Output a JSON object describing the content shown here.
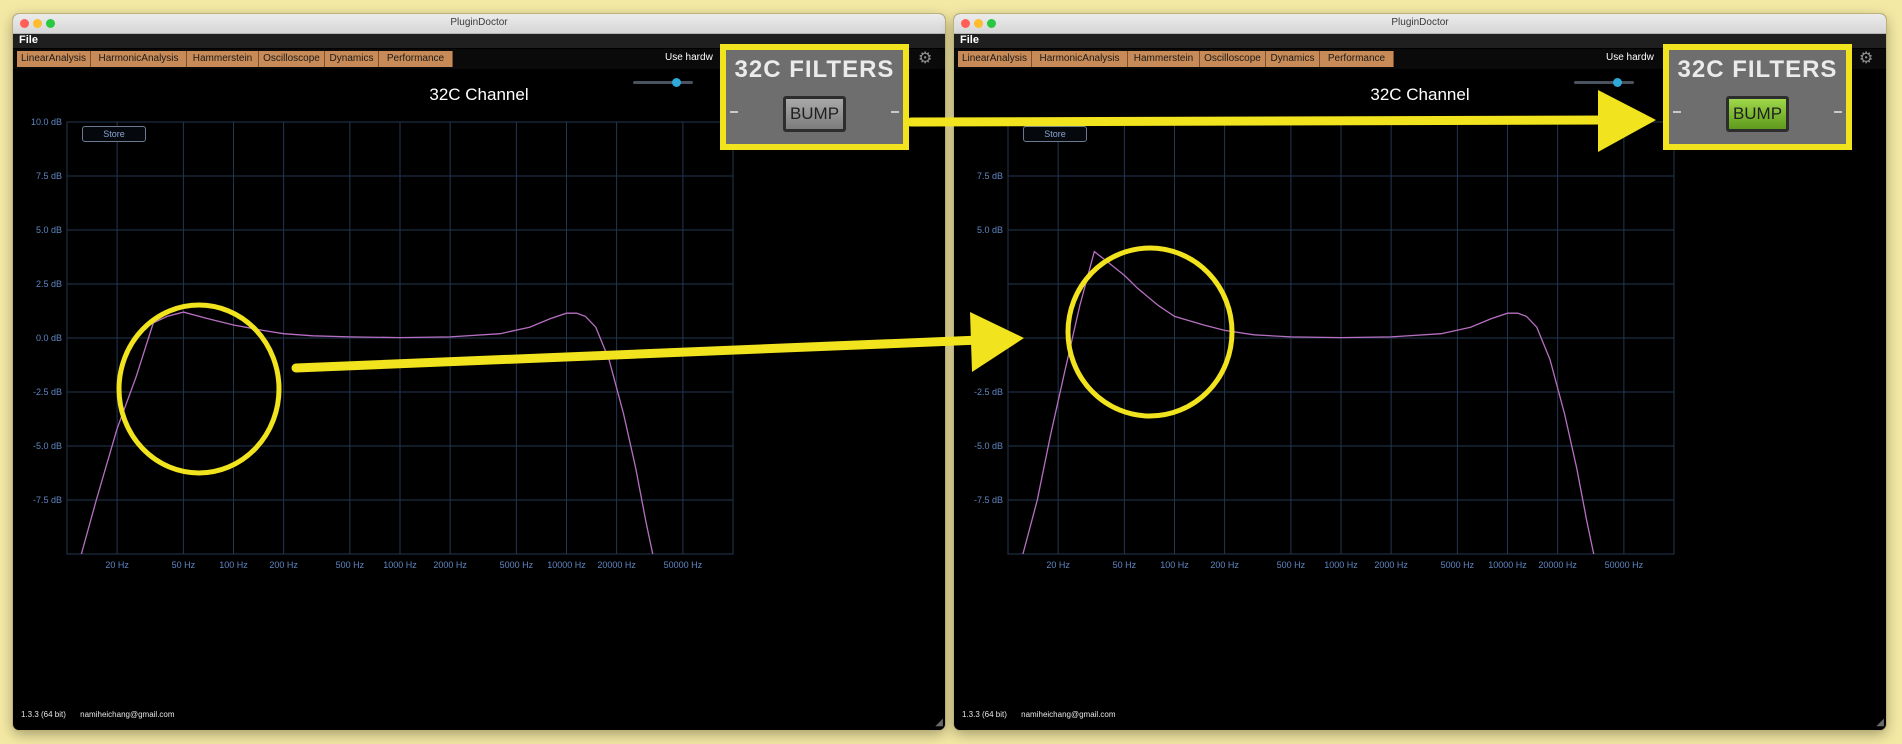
{
  "colors": {
    "highlight": "#f1e31d",
    "curve": "#b66fc1",
    "grid": "#233651",
    "tab": "#c88b57",
    "bump_on": "#7cc33a"
  },
  "window_title": "PluginDoctor",
  "menu": {
    "file": "File"
  },
  "tabs": [
    "LinearAnalysis",
    "HarmonicAnalysis",
    "Hammerstein",
    "Oscilloscope",
    "Dynamics",
    "Performance"
  ],
  "use_hardware_label": "Use hardw",
  "gear_icon": "gear-icon",
  "store_button": "Store",
  "footer": {
    "version": "1.3.3 (64 bit)",
    "email": "namiheichang@gmail.com"
  },
  "filters_panel": {
    "title": "32C FILTERS",
    "button": "BUMP"
  },
  "left": {
    "bump_state": "off",
    "slider_level": 0.72
  },
  "right": {
    "bump_state": "on",
    "slider_level": 0.72
  },
  "chart_data": [
    {
      "type": "line",
      "title": "32C Channel",
      "x_scale": "log",
      "xlim": [
        10,
        100000
      ],
      "ylim": [
        -10,
        10
      ],
      "grid": true,
      "y_ticks": [
        10,
        7.5,
        5,
        2.5,
        0,
        -2.5,
        -5,
        -7.5
      ],
      "y_tick_labels": [
        "10.0 dB",
        "7.5 dB",
        "5.0 dB",
        "2.5 dB",
        "0.0 dB",
        "-2.5 dB",
        "-5.0 dB",
        "-7.5 dB"
      ],
      "x_ticks": [
        20,
        50,
        100,
        200,
        500,
        1000,
        2000,
        5000,
        10000,
        20000,
        50000
      ],
      "x_tick_labels": [
        "20 Hz",
        "50 Hz",
        "100 Hz",
        "200 Hz",
        "500 Hz",
        "1000 Hz",
        "2000 Hz",
        "5000 Hz",
        "10000 Hz",
        "20000 Hz",
        "50000 Hz"
      ],
      "series": [
        {
          "x": [
            12,
            15,
            20,
            26,
            33,
            40,
            50,
            70,
            100,
            150,
            200,
            300,
            500,
            1000,
            2000,
            4000,
            6000,
            8000,
            10000,
            11500,
            13000,
            15000,
            18000,
            22000,
            26000,
            30000,
            34000
          ],
          "y": [
            -10.2,
            -7.5,
            -4.2,
            -1.8,
            0.7,
            1.0,
            1.2,
            0.9,
            0.6,
            0.35,
            0.2,
            0.1,
            0.05,
            0.02,
            0.05,
            0.2,
            0.5,
            0.9,
            1.15,
            1.15,
            1.0,
            0.5,
            -1.0,
            -3.5,
            -6.0,
            -8.5,
            -10.5
          ]
        }
      ]
    },
    {
      "type": "line",
      "title": "32C Channel",
      "x_scale": "log",
      "xlim": [
        10,
        100000
      ],
      "ylim": [
        -10,
        10
      ],
      "grid": true,
      "y_ticks": [
        7.5,
        5,
        2.5,
        0,
        -2.5,
        -5,
        -7.5
      ],
      "y_tick_labels": [
        "7.5 dB",
        "5.0 dB",
        "",
        "0.0 dB",
        "-2.5 dB",
        "-5.0 dB",
        "-7.5 dB"
      ],
      "x_ticks": [
        20,
        50,
        100,
        200,
        500,
        1000,
        2000,
        5000,
        10000,
        20000,
        50000
      ],
      "x_tick_labels": [
        "20 Hz",
        "50 Hz",
        "100 Hz",
        "200 Hz",
        "500 Hz",
        "1000 Hz",
        "2000 Hz",
        "5000 Hz",
        "10000 Hz",
        "20000 Hz",
        "50000 Hz"
      ],
      "series": [
        {
          "x": [
            12,
            15,
            18,
            22,
            27,
            33,
            40,
            50,
            60,
            80,
            100,
            150,
            200,
            300,
            500,
            1000,
            2000,
            4000,
            6000,
            8000,
            10000,
            11500,
            13000,
            15000,
            18000,
            22000,
            26000,
            30000,
            34000
          ],
          "y": [
            -10.3,
            -7.5,
            -4.5,
            -1.5,
            1.5,
            4.0,
            3.5,
            2.9,
            2.3,
            1.5,
            1.0,
            0.6,
            0.35,
            0.15,
            0.05,
            0.02,
            0.05,
            0.2,
            0.5,
            0.9,
            1.15,
            1.15,
            1.0,
            0.5,
            -1.0,
            -3.5,
            -6.0,
            -8.5,
            -10.5
          ]
        }
      ]
    }
  ]
}
